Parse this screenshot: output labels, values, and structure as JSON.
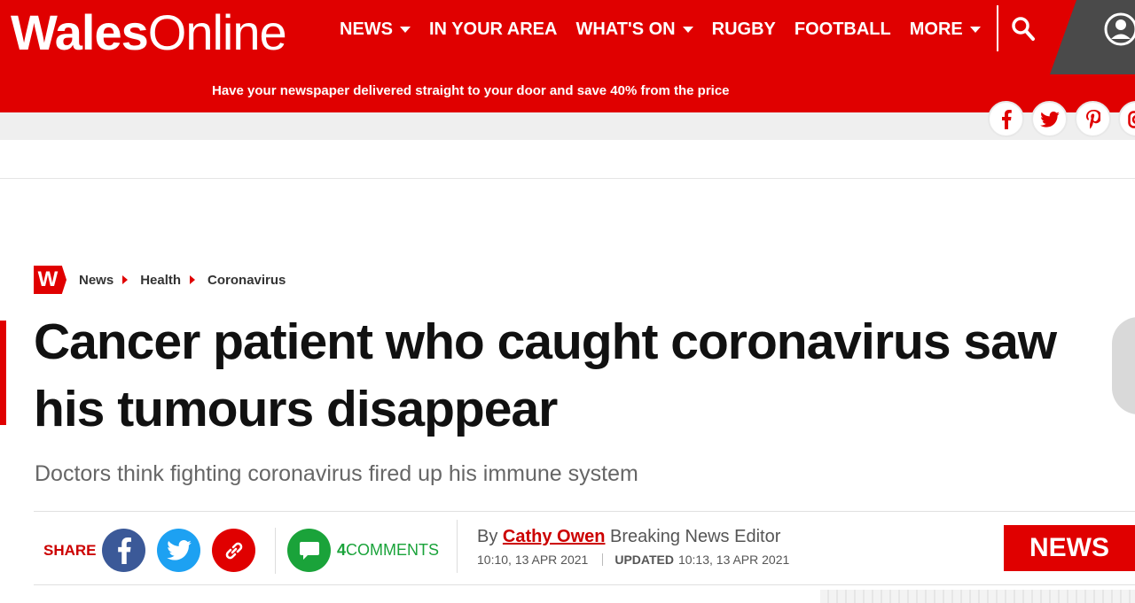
{
  "header": {
    "logo_bold": "Wales",
    "logo_light": "Online",
    "nav": [
      {
        "label": "NEWS",
        "dropdown": true
      },
      {
        "label": "IN YOUR AREA",
        "dropdown": false
      },
      {
        "label": "WHAT'S ON",
        "dropdown": true
      },
      {
        "label": "RUGBY",
        "dropdown": false
      },
      {
        "label": "FOOTBALL",
        "dropdown": false
      },
      {
        "label": "MORE",
        "dropdown": true
      }
    ],
    "promo": "Have your newspaper delivered straight to your door and save 40% from the price",
    "brand_color": "#e00000"
  },
  "social": [
    {
      "icon": "facebook-icon",
      "glyph": "f"
    },
    {
      "icon": "twitter-icon",
      "glyph": "t"
    },
    {
      "icon": "pinterest-icon",
      "glyph": "p"
    },
    {
      "icon": "instagram-icon",
      "glyph": "i"
    }
  ],
  "breadcrumb": {
    "badge": "W",
    "items": [
      "News",
      "Health",
      "Coronavirus"
    ]
  },
  "article": {
    "headline": "Cancer patient who caught coronavirus saw his tumours disappear",
    "standfirst": "Doctors think fighting coronavirus fired up his immune system",
    "share_label": "SHARE",
    "comments_count": "4",
    "comments_label": "COMMENTS",
    "by": "By",
    "author": "Cathy Owen",
    "author_role": "Breaking News Editor",
    "published": "10:10, 13 APR 2021",
    "updated_label": "UPDATED",
    "updated": "10:13, 13 APR 2021",
    "section_badge": "NEWS"
  },
  "colors": {
    "facebook": "#3b5998",
    "twitter": "#1da1f2",
    "link": "#e00000",
    "comments": "#1aa33a"
  }
}
